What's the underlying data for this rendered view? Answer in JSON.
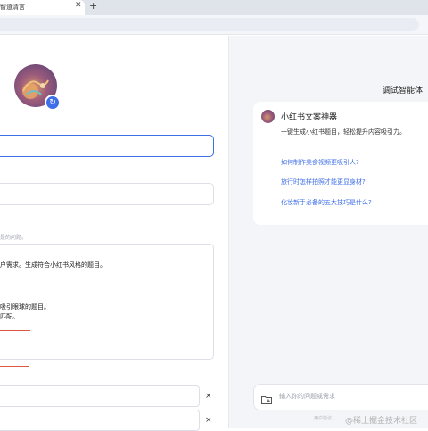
{
  "browser": {
    "tab_title": "智道清言",
    "tab_close": "✕",
    "new_tab": "+"
  },
  "prompt_editor": {
    "hint_text": "是的问题。",
    "lines": [
      "户需求。生成符合小红书风格的题目。",
      "吸引眼球的题目。",
      "匹配。"
    ],
    "question_rows": [
      {
        "value": "",
        "remove_label": "×"
      },
      {
        "value": "",
        "remove_label": "×"
      }
    ]
  },
  "debug_panel": {
    "title": "调试智能体",
    "bot": {
      "name": "小红书文案神器",
      "description": "一键生成小红书题目，轻松提升内容吸引力。"
    },
    "suggestions": [
      "如何制作美食视频更吸引人?",
      "旅行时怎样拍照才能更显身材?",
      "化妆新手必备的五大技巧是什么?"
    ],
    "chat_placeholder": "输入你的问题或需求",
    "footer_text": "用户协议"
  },
  "watermark": "@稀土掘金技术社区",
  "colors": {
    "accent": "#3e6ee8",
    "underline": "#e0593e"
  },
  "icons": {
    "avatar_refresh": "refresh-icon",
    "chat_attach": "folder-plus-icon"
  }
}
